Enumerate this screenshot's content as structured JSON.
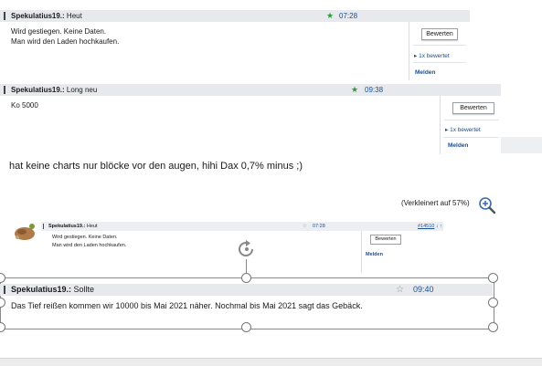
{
  "post1": {
    "user": "Spekulatius19.:",
    "subject": "Heut",
    "time": "07:28",
    "lines": [
      "Wird gestiegen. Keine Daten.",
      "Man wird den Laden hochkaufen."
    ],
    "rate_label": "Bewerten",
    "rated_label": "1x bewertet",
    "report_label": "Melden"
  },
  "post2": {
    "user": "Spekulatius19.:",
    "subject": "Long neu",
    "time": "09:38",
    "text": "Ko 5000",
    "rate_label": "Bewerten",
    "rated_label": "1x bewertet",
    "report_label": "Melden"
  },
  "comment": "hat keine charts nur blöcke vor den augen, hihi Dax 0,7% minus ;)",
  "zoom_note": "(Verkleinert auf 57%)",
  "embedded": {
    "user": "Spekulatius19.:",
    "subject": "Heut",
    "time": "07:28",
    "post_id": "#14510",
    "arrows": "↓ ↑",
    "lines": [
      "Wird gestiegen. Keine Daten.",
      "Man wird den Laden hochkaufen."
    ],
    "rate_label": "Bewerten",
    "report_label": "Melden"
  },
  "post3": {
    "user": "Spekulatius19.:",
    "subject": "Sollte",
    "time": "09:40",
    "text": "Das Tief reißen kommen wir 10000 bis Mai 2021 näher. Nochmal bis Mai 2021 sagt das Gebäck."
  },
  "icons": {
    "star": "green-star-icon",
    "zoom": "zoom-in-icon",
    "rotate": "rotate-icon"
  },
  "colors": {
    "star": "#2f9a3c",
    "link": "#1b4f91",
    "header": "#e7e9ec"
  }
}
